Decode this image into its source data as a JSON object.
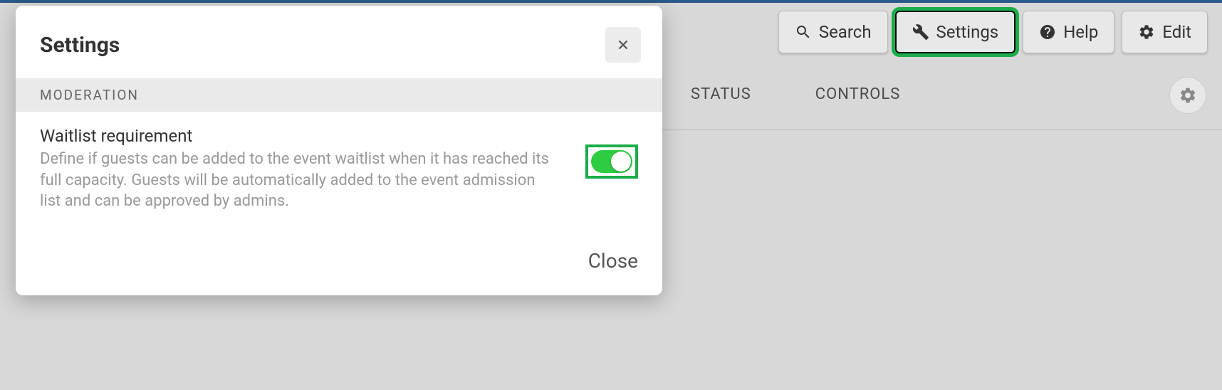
{
  "toolbar": {
    "search_label": "Search",
    "settings_label": "Settings",
    "help_label": "Help",
    "edit_label": "Edit"
  },
  "columns": {
    "status": "STATUS",
    "controls": "CONTROLS"
  },
  "modal": {
    "title": "Settings",
    "section": "MODERATION",
    "setting_title": "Waitlist requirement",
    "setting_desc": "Define if guests can be added to the event waitlist when it has reached its full capacity. Guests will be automatically added to the event admission list and can be approved by admins.",
    "close_label": "Close",
    "toggle_on": true
  },
  "colors": {
    "highlight": "#1aad4a",
    "toggle_on": "#2ecc40"
  }
}
